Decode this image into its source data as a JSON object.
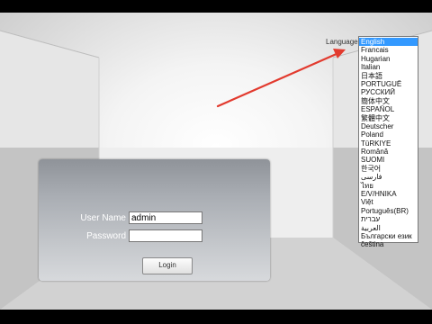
{
  "language": {
    "label": "Language",
    "selected": "English",
    "options": [
      "English",
      "Francais",
      "Hugarian",
      "Italian",
      "日本語",
      "PORTUGUÊ",
      "РУССКИЙ",
      "簡体中文",
      "ESPAÑOL",
      "繁體中文",
      "Deutscher",
      "Poland",
      "TüRKIYE",
      "Română",
      "SUOMI",
      "한국어",
      "فارسی",
      "ไทย",
      "Ε/V/HNIKA",
      "Việt",
      "Português(BR)",
      "עברית",
      "العربية",
      "Български език",
      "čeština"
    ]
  },
  "login": {
    "username_label": "User Name",
    "username_value": "admin",
    "password_label": "Password",
    "password_value": "",
    "login_button": "Login"
  },
  "colors": {
    "arrow": "#e23a2e",
    "selection": "#3399ff"
  }
}
